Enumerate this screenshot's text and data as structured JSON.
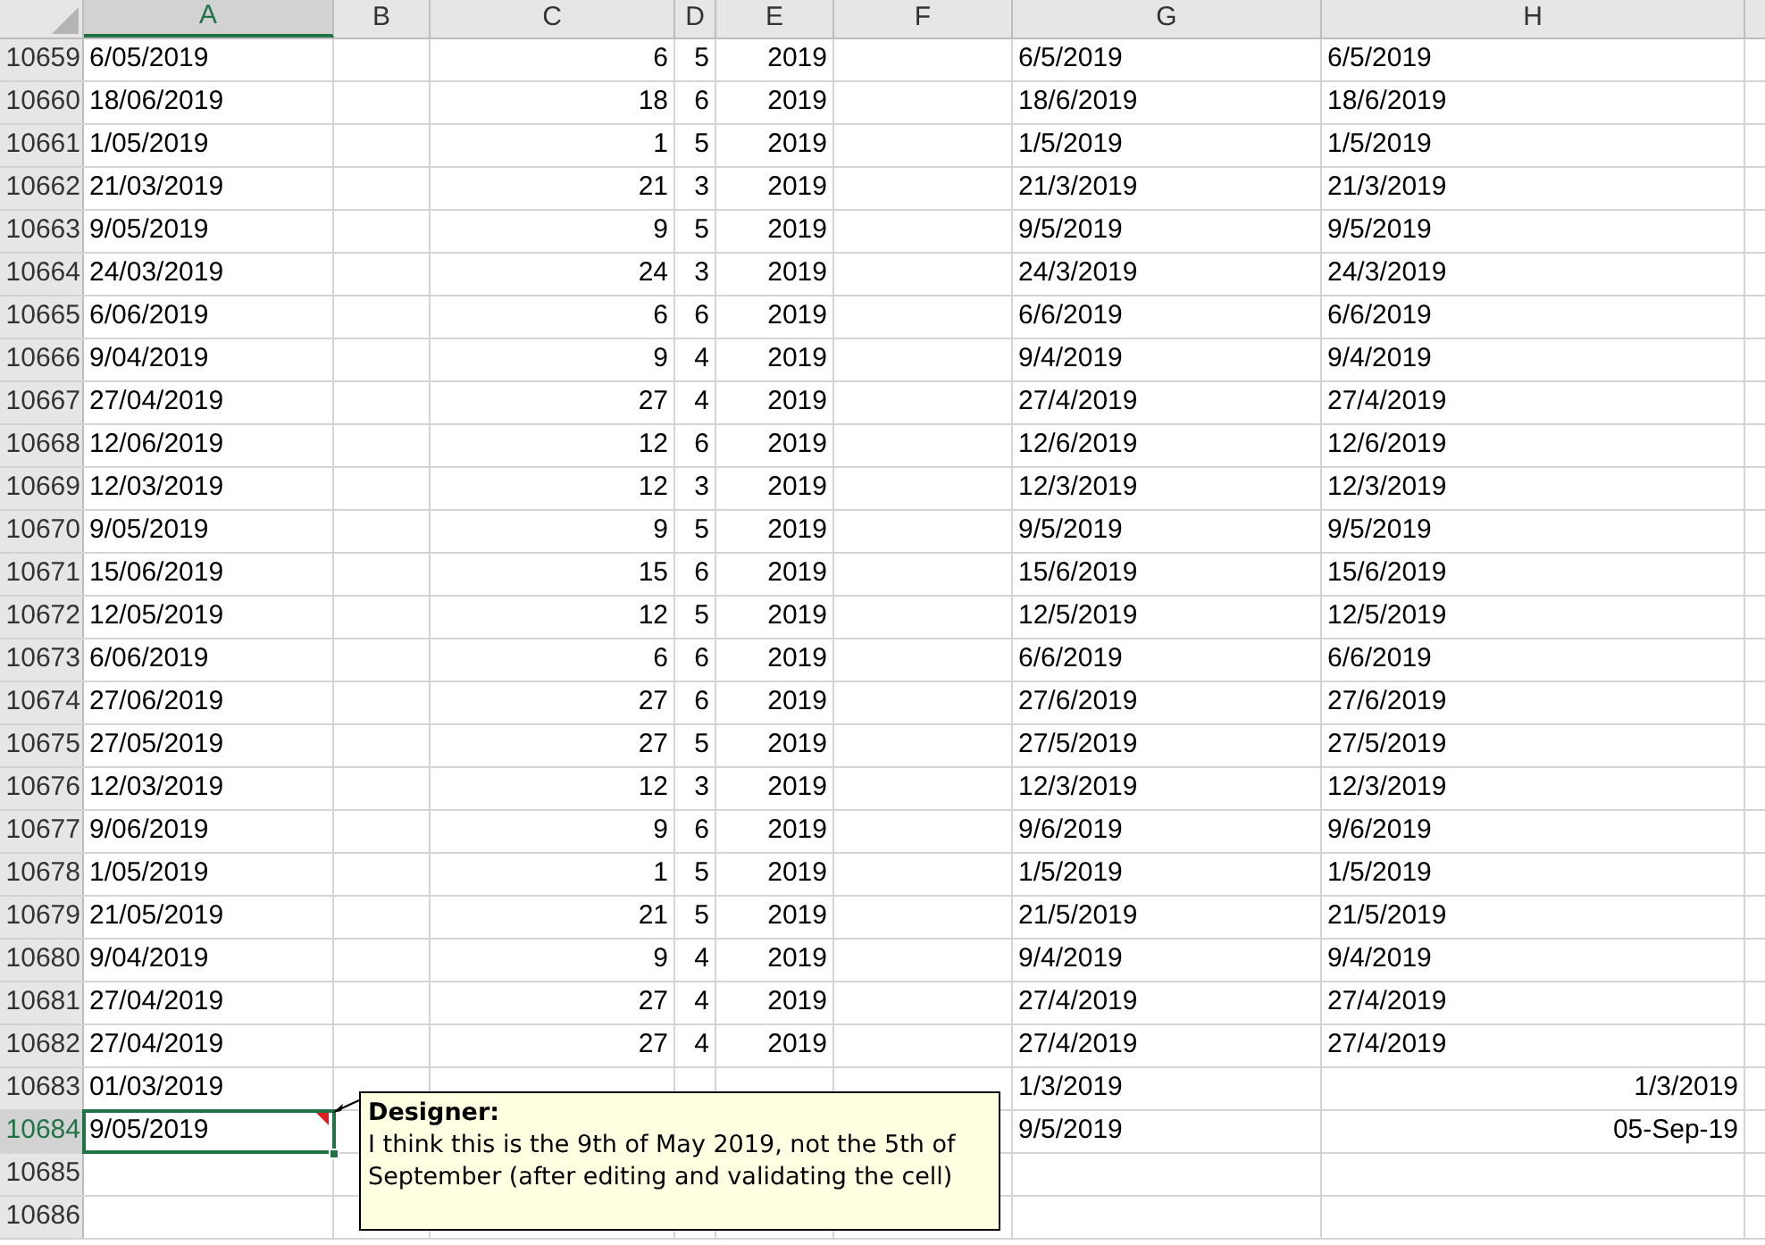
{
  "columns": [
    {
      "label": "A",
      "selected": true
    },
    {
      "label": "B",
      "selected": false
    },
    {
      "label": "C",
      "selected": false
    },
    {
      "label": "D",
      "selected": false
    },
    {
      "label": "E",
      "selected": false
    },
    {
      "label": "F",
      "selected": false
    },
    {
      "label": "G",
      "selected": false
    },
    {
      "label": "H",
      "selected": false
    }
  ],
  "rows": [
    {
      "header": "10659",
      "selected": false,
      "A": "6/05/2019",
      "C": "6",
      "D": "5",
      "E": "2019",
      "G": "6/5/2019",
      "H": "6/5/2019",
      "h_date": false
    },
    {
      "header": "10660",
      "selected": false,
      "A": "18/06/2019",
      "C": "18",
      "D": "6",
      "E": "2019",
      "G": "18/6/2019",
      "H": "18/6/2019",
      "h_date": false
    },
    {
      "header": "10661",
      "selected": false,
      "A": "1/05/2019",
      "C": "1",
      "D": "5",
      "E": "2019",
      "G": "1/5/2019",
      "H": "1/5/2019",
      "h_date": false
    },
    {
      "header": "10662",
      "selected": false,
      "A": "21/03/2019",
      "C": "21",
      "D": "3",
      "E": "2019",
      "G": "21/3/2019",
      "H": "21/3/2019",
      "h_date": false
    },
    {
      "header": "10663",
      "selected": false,
      "A": "9/05/2019",
      "C": "9",
      "D": "5",
      "E": "2019",
      "G": "9/5/2019",
      "H": "9/5/2019",
      "h_date": false
    },
    {
      "header": "10664",
      "selected": false,
      "A": "24/03/2019",
      "C": "24",
      "D": "3",
      "E": "2019",
      "G": "24/3/2019",
      "H": "24/3/2019",
      "h_date": false
    },
    {
      "header": "10665",
      "selected": false,
      "A": "6/06/2019",
      "C": "6",
      "D": "6",
      "E": "2019",
      "G": "6/6/2019",
      "H": "6/6/2019",
      "h_date": false
    },
    {
      "header": "10666",
      "selected": false,
      "A": "9/04/2019",
      "C": "9",
      "D": "4",
      "E": "2019",
      "G": "9/4/2019",
      "H": "9/4/2019",
      "h_date": false
    },
    {
      "header": "10667",
      "selected": false,
      "A": "27/04/2019",
      "C": "27",
      "D": "4",
      "E": "2019",
      "G": "27/4/2019",
      "H": "27/4/2019",
      "h_date": false
    },
    {
      "header": "10668",
      "selected": false,
      "A": "12/06/2019",
      "C": "12",
      "D": "6",
      "E": "2019",
      "G": "12/6/2019",
      "H": "12/6/2019",
      "h_date": false
    },
    {
      "header": "10669",
      "selected": false,
      "A": "12/03/2019",
      "C": "12",
      "D": "3",
      "E": "2019",
      "G": "12/3/2019",
      "H": "12/3/2019",
      "h_date": false
    },
    {
      "header": "10670",
      "selected": false,
      "A": "9/05/2019",
      "C": "9",
      "D": "5",
      "E": "2019",
      "G": "9/5/2019",
      "H": "9/5/2019",
      "h_date": false
    },
    {
      "header": "10671",
      "selected": false,
      "A": "15/06/2019",
      "C": "15",
      "D": "6",
      "E": "2019",
      "G": "15/6/2019",
      "H": "15/6/2019",
      "h_date": false
    },
    {
      "header": "10672",
      "selected": false,
      "A": "12/05/2019",
      "C": "12",
      "D": "5",
      "E": "2019",
      "G": "12/5/2019",
      "H": "12/5/2019",
      "h_date": false
    },
    {
      "header": "10673",
      "selected": false,
      "A": "6/06/2019",
      "C": "6",
      "D": "6",
      "E": "2019",
      "G": "6/6/2019",
      "H": "6/6/2019",
      "h_date": false
    },
    {
      "header": "10674",
      "selected": false,
      "A": "27/06/2019",
      "C": "27",
      "D": "6",
      "E": "2019",
      "G": "27/6/2019",
      "H": "27/6/2019",
      "h_date": false
    },
    {
      "header": "10675",
      "selected": false,
      "A": "27/05/2019",
      "C": "27",
      "D": "5",
      "E": "2019",
      "G": "27/5/2019",
      "H": "27/5/2019",
      "h_date": false
    },
    {
      "header": "10676",
      "selected": false,
      "A": "12/03/2019",
      "C": "12",
      "D": "3",
      "E": "2019",
      "G": "12/3/2019",
      "H": "12/3/2019",
      "h_date": false
    },
    {
      "header": "10677",
      "selected": false,
      "A": "9/06/2019",
      "C": "9",
      "D": "6",
      "E": "2019",
      "G": "9/6/2019",
      "H": "9/6/2019",
      "h_date": false
    },
    {
      "header": "10678",
      "selected": false,
      "A": "1/05/2019",
      "C": "1",
      "D": "5",
      "E": "2019",
      "G": "1/5/2019",
      "H": "1/5/2019",
      "h_date": false
    },
    {
      "header": "10679",
      "selected": false,
      "A": "21/05/2019",
      "C": "21",
      "D": "5",
      "E": "2019",
      "G": "21/5/2019",
      "H": "21/5/2019",
      "h_date": false
    },
    {
      "header": "10680",
      "selected": false,
      "A": "9/04/2019",
      "C": "9",
      "D": "4",
      "E": "2019",
      "G": "9/4/2019",
      "H": "9/4/2019",
      "h_date": false
    },
    {
      "header": "10681",
      "selected": false,
      "A": "27/04/2019",
      "C": "27",
      "D": "4",
      "E": "2019",
      "G": "27/4/2019",
      "H": "27/4/2019",
      "h_date": false
    },
    {
      "header": "10682",
      "selected": false,
      "A": "27/04/2019",
      "C": "27",
      "D": "4",
      "E": "2019",
      "G": "27/4/2019",
      "H": "27/4/2019",
      "h_date": false
    },
    {
      "header": "10683",
      "selected": false,
      "A": "01/03/2019",
      "G": "1/3/2019",
      "H": "1/3/2019",
      "h_date": true
    },
    {
      "header": "10684",
      "selected": true,
      "A": "9/05/2019",
      "G": "9/5/2019",
      "H": "05-Sep-19",
      "h_date": true,
      "comment": true
    },
    {
      "header": "10685",
      "selected": false
    },
    {
      "header": "10686",
      "selected": false
    }
  ],
  "comment": {
    "author": "Designer:",
    "text": "I think this is the 9th of May 2019, not the 5th of September (after editing and validating the cell)"
  }
}
